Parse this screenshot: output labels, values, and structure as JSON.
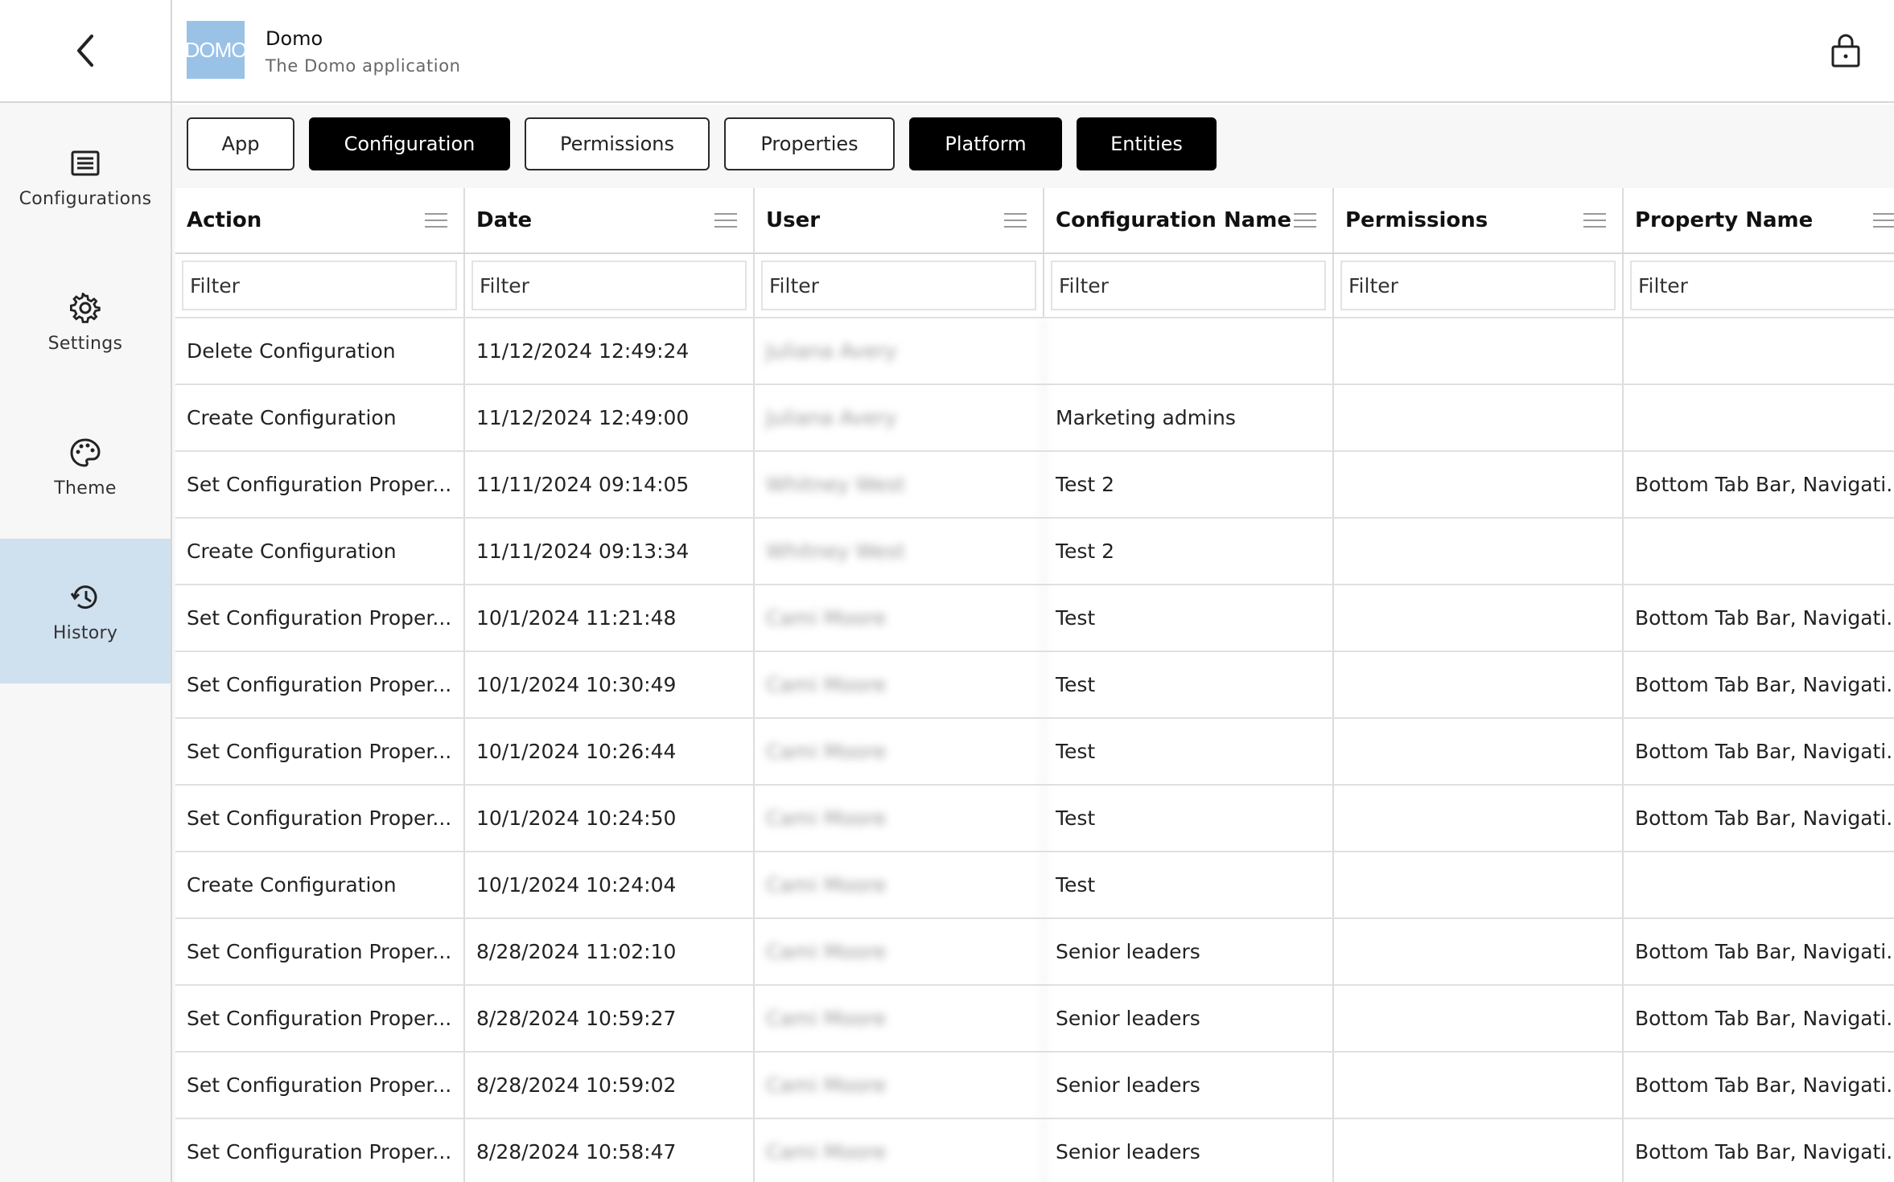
{
  "header": {
    "logo_text": "DOMO",
    "title": "Domo",
    "subtitle": "The Domo application"
  },
  "sidebar": {
    "items": [
      {
        "label": "Configurations",
        "icon": "list-icon"
      },
      {
        "label": "Settings",
        "icon": "gear-icon"
      },
      {
        "label": "Theme",
        "icon": "palette-icon"
      },
      {
        "label": "History",
        "icon": "history-icon"
      }
    ],
    "active": "History"
  },
  "tabs": [
    {
      "label": "App",
      "selected": false
    },
    {
      "label": "Configuration",
      "selected": true
    },
    {
      "label": "Permissions",
      "selected": false
    },
    {
      "label": "Properties",
      "selected": false
    },
    {
      "label": "Platform",
      "selected": true
    },
    {
      "label": "Entities",
      "selected": true
    }
  ],
  "table": {
    "columns": [
      "Action",
      "Date",
      "User",
      "Configuration Name",
      "Permissions",
      "Property Name"
    ],
    "filter_placeholder": "Filter",
    "rows": [
      [
        "Delete Configuration",
        "11/12/2024 12:49:24",
        "Juliana Avery",
        "",
        "",
        ""
      ],
      [
        "Create Configuration",
        "11/12/2024 12:49:00",
        "Juliana Avery",
        "Marketing admins",
        "",
        ""
      ],
      [
        "Set Configuration Proper...",
        "11/11/2024 09:14:05",
        "Whitney West",
        "Test 2",
        "",
        "Bottom Tab Bar, Navigati..."
      ],
      [
        "Create Configuration",
        "11/11/2024 09:13:34",
        "Whitney West",
        "Test 2",
        "",
        ""
      ],
      [
        "Set Configuration Proper...",
        "10/1/2024 11:21:48",
        "Cami Moore",
        "Test",
        "",
        "Bottom Tab Bar, Navigati..."
      ],
      [
        "Set Configuration Proper...",
        "10/1/2024 10:30:49",
        "Cami Moore",
        "Test",
        "",
        "Bottom Tab Bar, Navigati..."
      ],
      [
        "Set Configuration Proper...",
        "10/1/2024 10:26:44",
        "Cami Moore",
        "Test",
        "",
        "Bottom Tab Bar, Navigati..."
      ],
      [
        "Set Configuration Proper...",
        "10/1/2024 10:24:50",
        "Cami Moore",
        "Test",
        "",
        "Bottom Tab Bar, Navigati..."
      ],
      [
        "Create Configuration",
        "10/1/2024 10:24:04",
        "Cami Moore",
        "Test",
        "",
        ""
      ],
      [
        "Set Configuration Proper...",
        "8/28/2024 11:02:10",
        "Cami Moore",
        "Senior leaders",
        "",
        "Bottom Tab Bar, Navigati..."
      ],
      [
        "Set Configuration Proper...",
        "8/28/2024 10:59:27",
        "Cami Moore",
        "Senior leaders",
        "",
        "Bottom Tab Bar, Navigati..."
      ],
      [
        "Set Configuration Proper...",
        "8/28/2024 10:59:02",
        "Cami Moore",
        "Senior leaders",
        "",
        "Bottom Tab Bar, Navigati..."
      ],
      [
        "Set Configuration Proper...",
        "8/28/2024 10:58:47",
        "Cami Moore",
        "Senior leaders",
        "",
        "Bottom Tab Bar, Navigati..."
      ]
    ]
  },
  "colors": {
    "active_nav_bg": "#cfe0ef",
    "logo_bg": "#99c2e6",
    "selected_tab_bg": "#000000"
  }
}
